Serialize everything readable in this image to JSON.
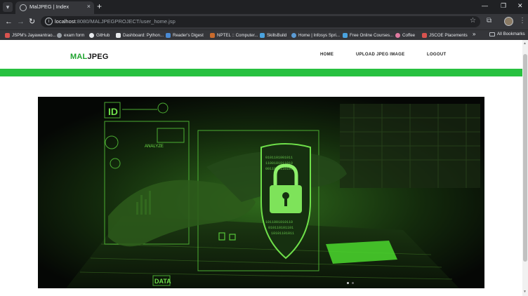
{
  "browser": {
    "tab_title": "MalJPEG | Index",
    "tab_close": "×",
    "new_tab": "+",
    "url_host": "localhost",
    "url_path": ":8080/MALJPEGPROJECT/user_home.jsp",
    "bookmarks": [
      {
        "label": "JSPM's Jayawantrao...",
        "color": "#d9534f"
      },
      {
        "label": "exam form",
        "color": "#9aa0a6"
      },
      {
        "label": "GitHub",
        "color": "#e8eaed"
      },
      {
        "label": "Dashboard: Python...",
        "color": "#e8eaed"
      },
      {
        "label": "Reader's Digest",
        "color": "#4a8ad4"
      },
      {
        "label": "NPTEL :: Computer...",
        "color": "#c96b2c"
      },
      {
        "label": "SkillsBuild",
        "color": "#4aa3df"
      },
      {
        "label": "Home | Infosys Spri...",
        "color": "#5b9bd5"
      },
      {
        "label": "Free Online Courses...",
        "color": "#4aa3df"
      },
      {
        "label": "Coffee",
        "color": "#e07aa0"
      },
      {
        "label": "JSCOE Placements",
        "color": "#d9534f"
      }
    ],
    "bookmarks_more": "»",
    "all_bookmarks": "All Bookmarks"
  },
  "site": {
    "logo_part1": "MAL",
    "logo_part2": "JPEG",
    "nav": [
      "HOME",
      "UPLOAD JPEG IMAGE",
      "LOGOUT"
    ],
    "accent_color": "#28c140"
  },
  "hero": {
    "badge_text": "ID",
    "panel_text": "ANALYZE",
    "data_label": "DATA",
    "slide_count": 2,
    "active_slide": 0
  }
}
